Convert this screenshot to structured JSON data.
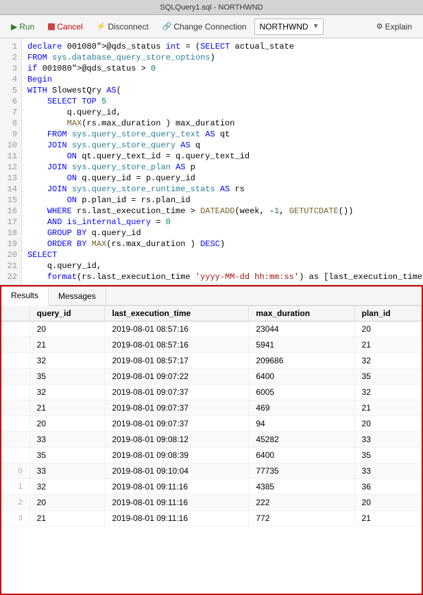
{
  "titlebar": {
    "text": "SQLQuery1.sql - NORTHWND"
  },
  "toolbar": {
    "run_label": "Run",
    "cancel_label": "Cancel",
    "disconnect_label": "Disconnect",
    "change_connection_label": "Change Connection",
    "explain_label": "Explain",
    "connection_name": "NORTHWND"
  },
  "code": {
    "lines": [
      "declare @qds_status int = (SELECT actual_state",
      "FROM sys.database_query_store_options)",
      "if @qds_status > 0",
      "Begin",
      "WITH SlowestQry AS(",
      "    SELECT TOP 5",
      "        q.query_id,",
      "        MAX(rs.max_duration ) max_duration",
      "    FROM sys.query_store_query_text AS qt",
      "    JOIN sys.query_store_query AS q",
      "        ON qt.query_text_id = q.query_text_id",
      "    JOIN sys.query_store_plan AS p",
      "        ON q.query_id = p.query_id",
      "    JOIN sys.query_store_runtime_stats AS rs",
      "        ON p.plan_id = rs.plan_id",
      "    WHERE rs.last_execution_time > DATEADD(week, -1, GETUTCDATE())",
      "    AND is_internal_query = 0",
      "    GROUP BY q.query_id",
      "    ORDER BY MAX(rs.max_duration ) DESC)",
      "SELECT",
      "    q.query_id,",
      "    format(rs.last_execution_time 'yyyy-MM-dd hh:mm:ss') as [last_execution_time]"
    ]
  },
  "results": {
    "tabs": [
      "Results",
      "Messages"
    ],
    "active_tab": "Results",
    "columns": [
      "query_id",
      "last_execution_time",
      "max_duration",
      "plan_id"
    ],
    "rows": [
      [
        "20",
        "2019-08-01 08:57:16",
        "23044",
        "20"
      ],
      [
        "21",
        "2019-08-01 08:57:16",
        "5941",
        "21"
      ],
      [
        "32",
        "2019-08-01 08:57:17",
        "209686",
        "32"
      ],
      [
        "35",
        "2019-08-01 09:07:22",
        "6400",
        "35"
      ],
      [
        "32",
        "2019-08-01 09:07:37",
        "6005",
        "32"
      ],
      [
        "21",
        "2019-08-01 09:07:37",
        "469",
        "21"
      ],
      [
        "20",
        "2019-08-01 09:07:37",
        "94",
        "20"
      ],
      [
        "33",
        "2019-08-01 09:08:12",
        "45282",
        "33"
      ],
      [
        "35",
        "2019-08-01 09:08:39",
        "6400",
        "35"
      ],
      [
        "33",
        "2019-08-01 09:10:04",
        "77735",
        "33"
      ],
      [
        "32",
        "2019-08-01 09:11:16",
        "4385",
        "36"
      ],
      [
        "20",
        "2019-08-01 09:11:16",
        "222",
        "20"
      ],
      [
        "21",
        "2019-08-01 09:11:16",
        "772",
        "21"
      ]
    ],
    "row_numbers": [
      "",
      "",
      "",
      "",
      "",
      "",
      "",
      "",
      "",
      "0",
      "1",
      "2",
      "3"
    ]
  }
}
